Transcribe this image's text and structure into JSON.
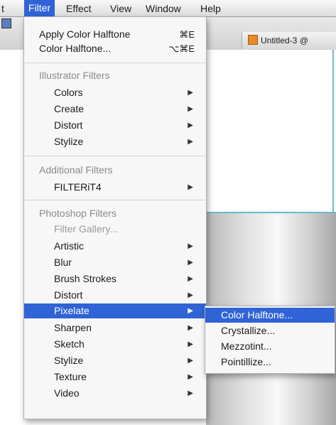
{
  "menubar": {
    "items": [
      "t",
      "Filter",
      "Effect",
      "View",
      "Window",
      "Help"
    ]
  },
  "document": {
    "tab_title": "Untitled-3 @"
  },
  "filter_menu": {
    "items": [
      {
        "label": "Apply Color Halftone",
        "shortcut": "⌘E"
      },
      {
        "label": "Color Halftone...",
        "shortcut": "⌥⌘E"
      },
      {
        "label": "Illustrator Filters"
      },
      {
        "label": "Colors"
      },
      {
        "label": "Create"
      },
      {
        "label": "Distort"
      },
      {
        "label": "Stylize"
      },
      {
        "label": "Additional Filters"
      },
      {
        "label": "FILTERiT4"
      },
      {
        "label": "Photoshop Filters"
      },
      {
        "label": "Filter Gallery..."
      },
      {
        "label": "Artistic"
      },
      {
        "label": "Blur"
      },
      {
        "label": "Brush Strokes"
      },
      {
        "label": "Distort"
      },
      {
        "label": "Pixelate"
      },
      {
        "label": "Sharpen"
      },
      {
        "label": "Sketch"
      },
      {
        "label": "Stylize"
      },
      {
        "label": "Texture"
      },
      {
        "label": "Video"
      }
    ]
  },
  "pixelate_submenu": {
    "items": [
      "Color Halftone...",
      "Crystallize...",
      "Mezzotint...",
      "Pointillize..."
    ]
  },
  "colors": {
    "highlight": "#2f63d6"
  }
}
